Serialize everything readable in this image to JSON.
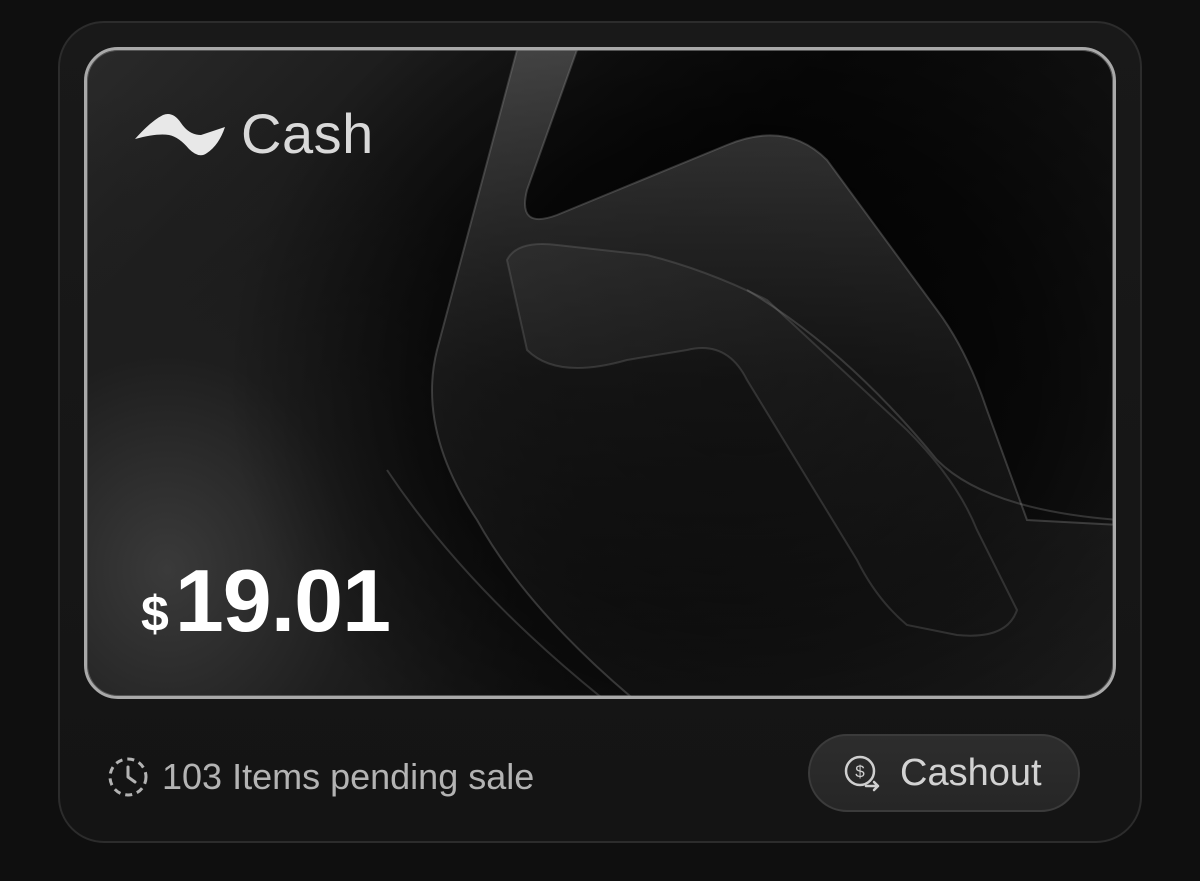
{
  "wallet": {
    "brand_label": "Cash",
    "logo_icon": "wave-logo-icon",
    "balance": {
      "currency_symbol": "$",
      "amount": "19.01"
    }
  },
  "status": {
    "icon": "clock-icon",
    "text": "103 Items pending sale"
  },
  "cashout": {
    "icon": "dollar-exchange-icon",
    "label": "Cashout"
  },
  "colors": {
    "background": "#0f0f0f",
    "panel": "#171717",
    "card_border": "#a9a9a9",
    "text_primary": "#ffffff",
    "text_secondary": "#b3b3b3"
  }
}
